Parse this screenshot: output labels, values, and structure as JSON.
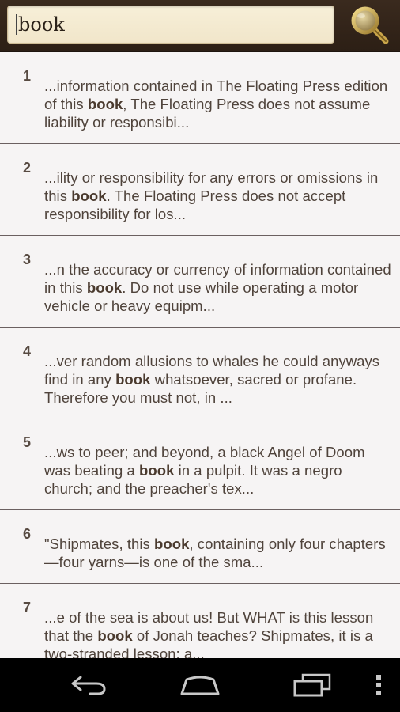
{
  "search": {
    "query": "book",
    "button_icon": "magnifier-icon"
  },
  "results": [
    {
      "number": "1",
      "before": "...information contained in The Floating Press edition of this ",
      "match": "book",
      "after": ", The Floating Press does not assume liability or responsibi..."
    },
    {
      "number": "2",
      "before": "...ility or responsibility for any errors or omissions in this ",
      "match": "book",
      "after": ". The Floating Press does not accept responsibility for los..."
    },
    {
      "number": "3",
      "before": "...n the accuracy or currency of information contained in this ",
      "match": "book",
      "after": ". Do not use while operating a motor vehicle or heavy equipm..."
    },
    {
      "number": "4",
      "before": "...ver random allusions to whales he could anyways find in any ",
      "match": "book",
      "after": " whatsoever, sacred or profane. Therefore you must not, in ..."
    },
    {
      "number": "5",
      "before": "...ws to peer; and beyond, a black Angel of Doom was beating a ",
      "match": "book",
      "after": " in a pulpit. It was a negro church; and the preacher's tex..."
    },
    {
      "number": "6",
      "before": "\"Shipmates, this ",
      "match": "book",
      "after": ", containing only four chapters—four yarns—is one of the sma..."
    },
    {
      "number": "7",
      "before": "...e of the sea is about us! But WHAT is this lesson that the ",
      "match": "book",
      "after": " of Jonah teaches? Shipmates, it is a two-stranded lesson; a..."
    }
  ],
  "navbar": {
    "back_icon": "back-icon",
    "home_icon": "home-icon",
    "recents_icon": "recent-apps-icon",
    "menu_icon": "overflow-menu-icon"
  },
  "colors": {
    "topbar": "#2c1f15",
    "search_field": "#f3e9cf",
    "result_text": "#4f433b",
    "divider": "#6b6060"
  }
}
